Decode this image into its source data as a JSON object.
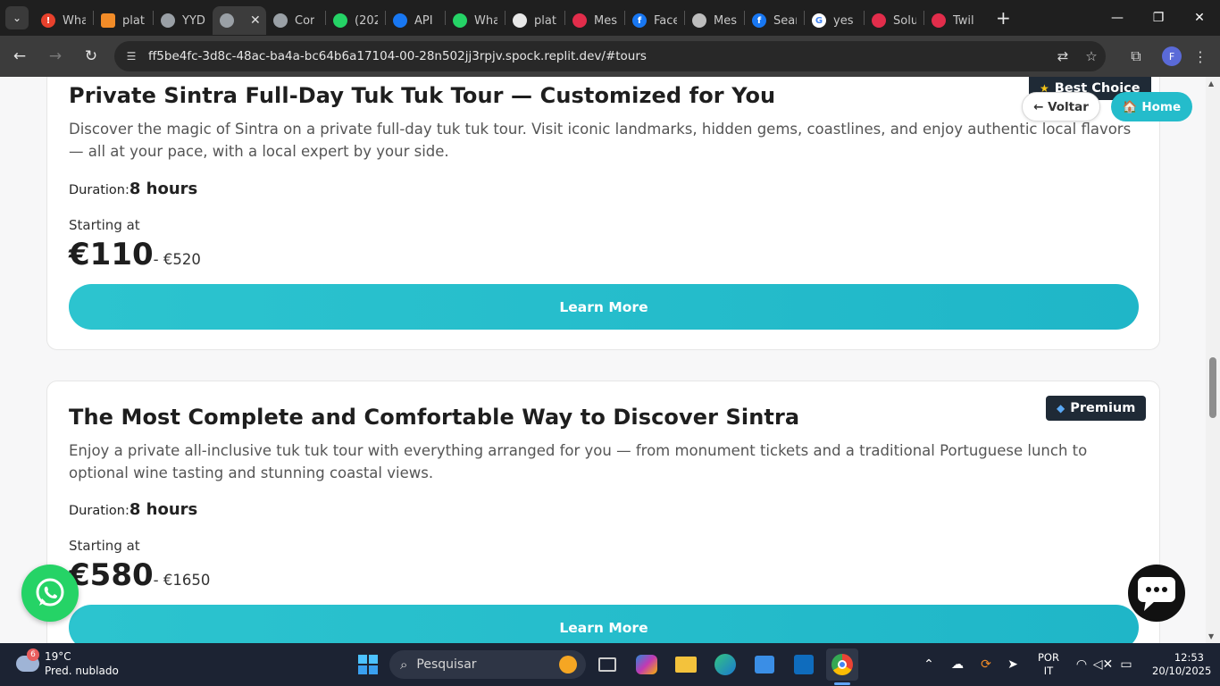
{
  "browser": {
    "tabs": [
      {
        "title": "Wha",
        "icon": "alert-icon",
        "color": "#e8412c"
      },
      {
        "title": "plat",
        "icon": "grid-icon",
        "color": "#f28c28"
      },
      {
        "title": "YYD",
        "icon": "globe-icon",
        "color": "#9aa0a6"
      },
      {
        "title": "",
        "icon": "globe-icon",
        "color": "#9aa0a6",
        "active": true
      },
      {
        "title": "Cor",
        "icon": "globe-icon",
        "color": "#9aa0a6"
      },
      {
        "title": "(202",
        "icon": "whatsapp-icon",
        "color": "#25d366"
      },
      {
        "title": "API",
        "icon": "react-icon",
        "color": "#1877f2"
      },
      {
        "title": "Wha",
        "icon": "whatsapp-icon",
        "color": "#25d366"
      },
      {
        "title": "plat",
        "icon": "github-icon",
        "color": "#e8e8e8"
      },
      {
        "title": "Mes",
        "icon": "twilio-icon",
        "color": "#e22d4b"
      },
      {
        "title": "Face",
        "icon": "facebook-icon",
        "color": "#1877f2"
      },
      {
        "title": "Mes",
        "icon": "meta-icon",
        "color": "#bdbdbd"
      },
      {
        "title": "Sear",
        "icon": "facebook-icon",
        "color": "#1877f2"
      },
      {
        "title": "yes",
        "icon": "google-icon",
        "color": "#ffffff"
      },
      {
        "title": "Solu",
        "icon": "twilio-icon",
        "color": "#e22d4b"
      },
      {
        "title": "Twil",
        "icon": "twilio-icon",
        "color": "#e22d4b"
      }
    ],
    "url": "ff5be4fc-3d8c-48ac-ba4a-bc64b6a17104-00-28n502jj3rpjv.spock.replit.dev/#tours",
    "profile_initial": "F"
  },
  "nav": {
    "back_label": "← Voltar",
    "home_label": "🏠 Home"
  },
  "tours": [
    {
      "title": "Private Sintra Full-Day Tuk Tuk Tour — Customized for You",
      "description": "Discover the magic of Sintra on a private full-day tuk tuk tour. Visit iconic landmarks, hidden gems, coastlines, and enjoy authentic local flavors — all at your pace, with a local expert by your side.",
      "duration_label": "Duration:",
      "duration_value": "8 hours",
      "starting_label": "Starting at",
      "price": "€110",
      "price_range": "- €520",
      "button": "Learn More",
      "badge": "Best Choice",
      "badge_icon": "star-icon"
    },
    {
      "title": "The Most Complete and Comfortable Way to Discover Sintra",
      "description": "Enjoy a private all-inclusive tuk tuk tour with everything arranged for you — from monument tickets and a traditional Portuguese lunch to optional wine tasting and stunning coastal views.",
      "duration_label": "Duration:",
      "duration_value": "8 hours",
      "starting_label": "Starting at",
      "price": "€580",
      "price_range": "- €1650",
      "button": "Learn More",
      "badge": "Premium",
      "badge_icon": "gem-icon"
    }
  ],
  "taskbar": {
    "weather_temp": "19°C",
    "weather_cond": "Pred. nublado",
    "weather_badge": "6",
    "search_placeholder": "Pesquisar",
    "lang_line1": "POR",
    "lang_line2": "IT",
    "time": "12:53",
    "date": "20/10/2025"
  },
  "colors": {
    "accent": "#24bccb",
    "badge_bg": "#1f2a36",
    "whatsapp": "#25d366"
  }
}
